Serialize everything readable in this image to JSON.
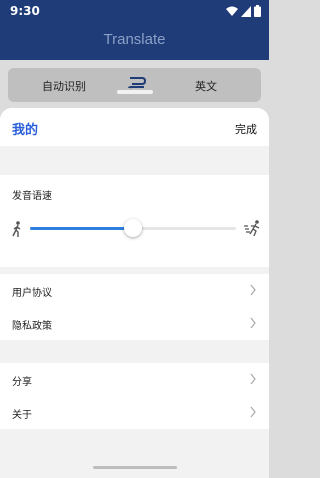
{
  "status": {
    "time": "9:30"
  },
  "app": {
    "title": "Translate"
  },
  "languages": {
    "source": "自动识别",
    "target": "英文"
  },
  "sheet": {
    "title": "我的",
    "done_label": "完成",
    "speech_speed": {
      "label": "发音语速",
      "level": 0.5
    },
    "group1": [
      {
        "label": "用户协议"
      },
      {
        "label": "隐私政策"
      }
    ],
    "group2": [
      {
        "label": "分享"
      },
      {
        "label": "关于"
      }
    ]
  },
  "colors": {
    "header": "#1f3c78",
    "accent": "#2b5fd9",
    "slider": "#2f7fe0"
  },
  "icons": [
    "wifi-icon",
    "signal-icon",
    "battery-icon",
    "swap-icon",
    "walk-icon",
    "run-icon",
    "chevron-right-icon"
  ]
}
